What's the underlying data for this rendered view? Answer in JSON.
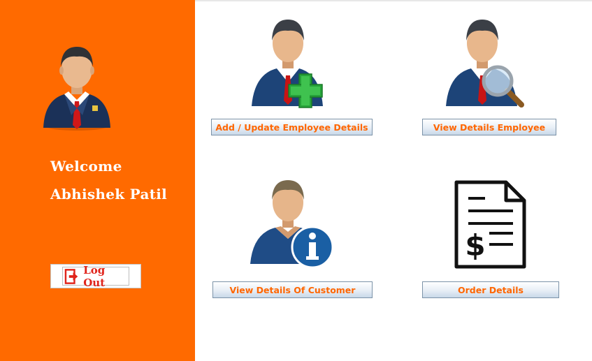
{
  "sidebar": {
    "welcome_text": "Welcome",
    "user_name": "Abhishek Patil",
    "logout_label": "Log Out",
    "background_color": "#ff6a00"
  },
  "tiles": [
    {
      "label": "Add / Update Employee Details",
      "icon": "employee-add-icon"
    },
    {
      "label": "View Details Employee",
      "icon": "employee-search-icon"
    },
    {
      "label": "View Details Of Customer",
      "icon": "customer-info-icon"
    },
    {
      "label": "Order Details",
      "icon": "invoice-dollar-icon"
    }
  ],
  "colors": {
    "button_text": "#ff6600",
    "accent": "#ff6a00"
  }
}
